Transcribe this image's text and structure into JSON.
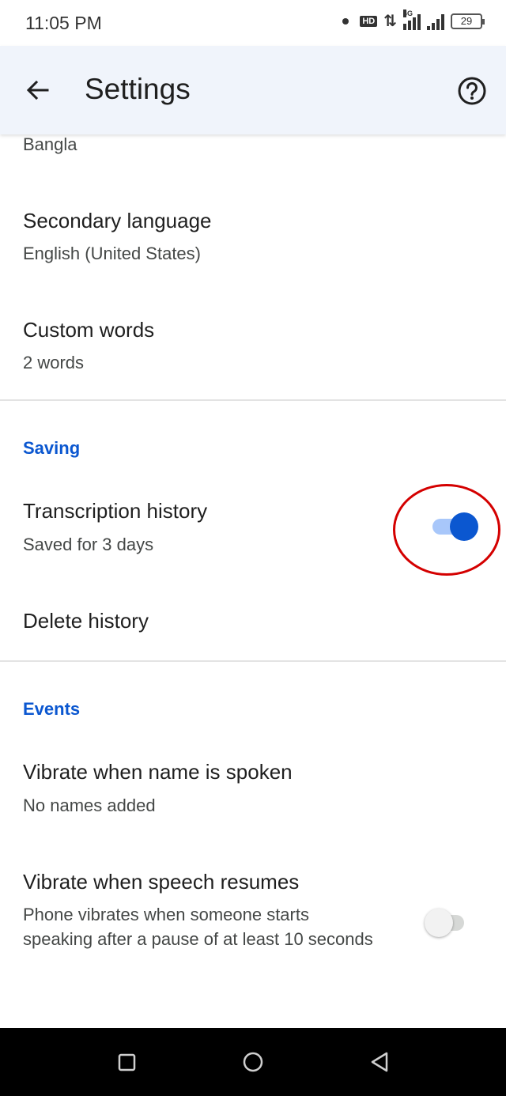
{
  "status_bar": {
    "time": "11:05 PM",
    "hd_label": "HD",
    "network_label": "4G",
    "battery_level": "29"
  },
  "app_bar": {
    "title": "Settings",
    "back_icon": "arrow-left-icon",
    "help_icon": "help-circle-icon"
  },
  "language": {
    "primary_value": "Bangla",
    "secondary_title": "Secondary language",
    "secondary_value": "English (United States)",
    "custom_words_title": "Custom words",
    "custom_words_value": "2 words"
  },
  "saving": {
    "header": "Saving",
    "transcription_history_title": "Transcription history",
    "transcription_history_value": "Saved for 3 days",
    "transcription_history_enabled": true,
    "delete_history_title": "Delete history"
  },
  "events": {
    "header": "Events",
    "vibrate_name_title": "Vibrate when name is spoken",
    "vibrate_name_value": "No names added",
    "vibrate_speech_title": "Vibrate when speech resumes",
    "vibrate_speech_desc": "Phone vibrates when someone starts speaking after a pause of at least 10 seconds",
    "vibrate_speech_enabled": false
  },
  "colors": {
    "accent": "#0b57d0",
    "toggle_track_on": "#a8c7fa",
    "app_bar_bg": "#f0f4fb",
    "highlight": "#d40000"
  },
  "nav_bar": {
    "recents_icon": "square-icon",
    "home_icon": "circle-icon",
    "back_icon": "triangle-back-icon"
  }
}
